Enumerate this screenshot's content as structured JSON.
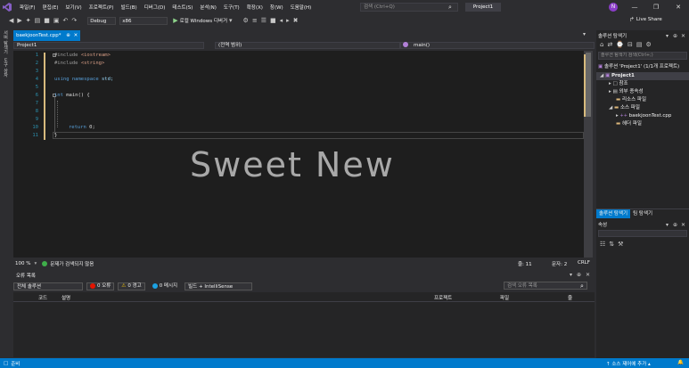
{
  "menu": [
    "파일(F)",
    "편집(E)",
    "보기(V)",
    "프로젝트(P)",
    "빌드(B)",
    "디버그(D)",
    "테스트(S)",
    "분석(N)",
    "도구(T)",
    "확장(X)",
    "창(W)",
    "도움말(H)"
  ],
  "search": {
    "placeholder": "검색 (Ctrl+Q)"
  },
  "solution_title": "Project1",
  "avatar_letter": "N",
  "live_share": "Live Share",
  "toolbar": {
    "config": "Debug",
    "platform": "x86",
    "run_label": "로컬 Windows 디버거"
  },
  "left_rail": [
    "서버 탐색기",
    "도구 상자"
  ],
  "editor": {
    "tab_label": "baekjoonTest.cpp*",
    "nav_project": "Project1",
    "nav_scope": "(전역 범위)",
    "nav_member": "main()",
    "line_numbers": [
      "1",
      "2",
      "3",
      "4",
      "5",
      "6",
      "7",
      "8",
      "9",
      "10",
      "11"
    ],
    "lines": [
      [
        "#include <iostream>"
      ],
      [
        "#include <string>"
      ],
      [
        ""
      ],
      [
        "using namespace std;"
      ],
      [
        ""
      ],
      [
        "int main() {"
      ],
      [
        ""
      ],
      [
        ""
      ],
      [
        ""
      ],
      [
        "return 0;"
      ],
      [
        "}"
      ]
    ],
    "watermark": "Sweet New",
    "zoom": "100 %",
    "issues": "문제가 검색되지 않음",
    "line_pos": "줄: 11",
    "col_pos": "문자: 2",
    "eol": "CRLF"
  },
  "error_list": {
    "title": "오류 목록",
    "scope": "전체 솔루션",
    "errors": "0 오류",
    "warnings": "0 경고",
    "messages": "0 메시지",
    "filter": "빌드 + IntelliSense",
    "search_placeholder": "검색 오류 목록",
    "cols": [
      "코드",
      "설명",
      "프로젝트",
      "파일",
      "줄"
    ]
  },
  "solution_explorer": {
    "title": "솔루션 탐색기",
    "search_placeholder": "솔루션 탐색기 검색(Ctrl+;)",
    "solution_line": "솔루션 'Project1' (1/1개 프로젝트)",
    "items": [
      {
        "label": "Project1",
        "level": 1,
        "bold": true
      },
      {
        "label": "참조",
        "level": 2
      },
      {
        "label": "외부 종속성",
        "level": 2
      },
      {
        "label": "리소스 파일",
        "level": 2
      },
      {
        "label": "소스 파일",
        "level": 2
      },
      {
        "label": "baekjoonTest.cpp",
        "level": 3
      },
      {
        "label": "헤더 파일",
        "level": 2
      }
    ],
    "tab_solution": "솔루션 탐색기",
    "tab_team": "팀 탐색기",
    "props_title": "속성"
  },
  "statusbar": {
    "left": "준비",
    "right": "소스 제어에 추가"
  },
  "colors": {
    "accent": "#007acc",
    "bg": "#2d2d30",
    "editor": "#1e1e1e",
    "keyword": "#569cd6",
    "string": "#d69d85",
    "comment": "#57a64a"
  }
}
